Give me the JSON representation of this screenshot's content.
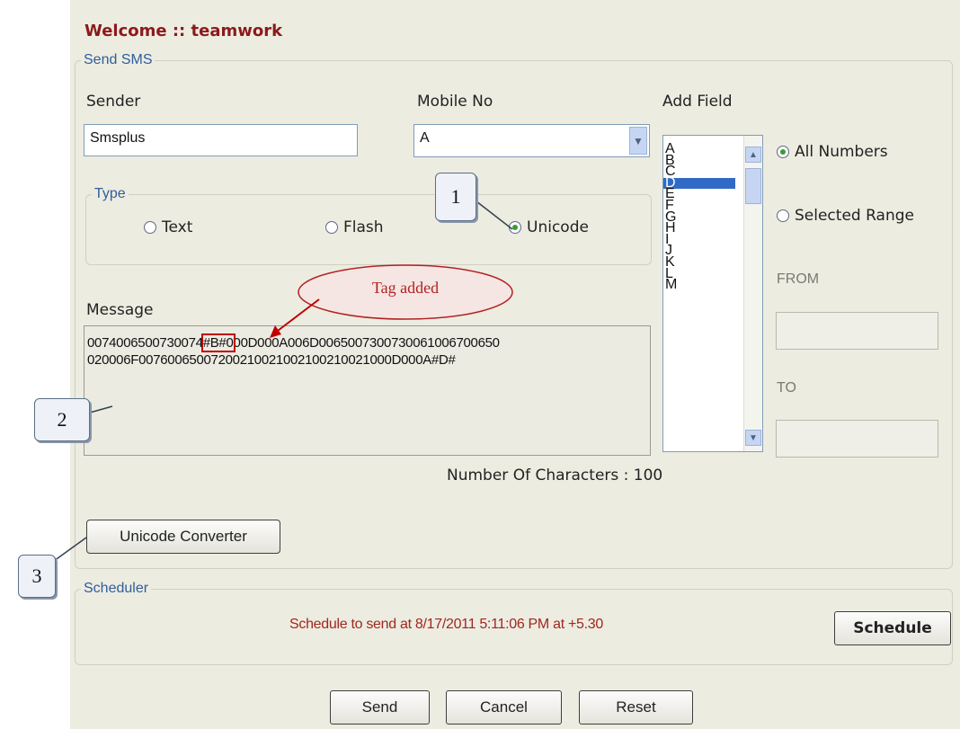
{
  "welcome": "Welcome :: teamwork",
  "send_sms": {
    "legend": "Send SMS",
    "sender_label": "Sender",
    "sender_value": "Smsplus",
    "mobile_label": "Mobile No",
    "mobile_value": "A",
    "add_field_label": "Add Field",
    "type_legend": "Type",
    "type_options": [
      "Text",
      "Flash",
      "Unicode"
    ],
    "type_selected": "Unicode",
    "message_label": "Message",
    "message_line1": "007400650073007",
    "message_line1_tag_prefix": "4",
    "message_line1_tag": "#B#0",
    "message_line1_rest": "00D000A006D006500730073006100670065​0",
    "message_line2": "020006F00760065007200210021002100210021000D000A#D#",
    "char_count": "Number Of Characters : 100",
    "fields": [
      "A",
      "B",
      "C",
      "D",
      "E",
      "F",
      "G",
      "H",
      "I",
      "J",
      "K",
      "L",
      "M"
    ],
    "selected_field": "D",
    "range_options": [
      "All Numbers",
      "Selected Range"
    ],
    "range_selected": "All Numbers",
    "from_label": "FROM",
    "to_label": "TO",
    "unicode_converter": "Unicode Converter"
  },
  "scheduler": {
    "legend": "Scheduler",
    "text": "Schedule to send at 8/17/2011 5:11:06 PM at +5.30",
    "button": "Schedule"
  },
  "actions": {
    "send": "Send",
    "cancel": "Cancel",
    "reset": "Reset"
  },
  "annotations": {
    "tag_added": "Tag added",
    "callout_1": "1",
    "callout_2": "2",
    "callout_3": "3"
  },
  "colors": {
    "welcome": "#8b1a1a",
    "legend": "#2e5e9b",
    "scheduler_text": "#a0281e",
    "selected_item": "#316ac5",
    "annotation": "#c00000"
  }
}
